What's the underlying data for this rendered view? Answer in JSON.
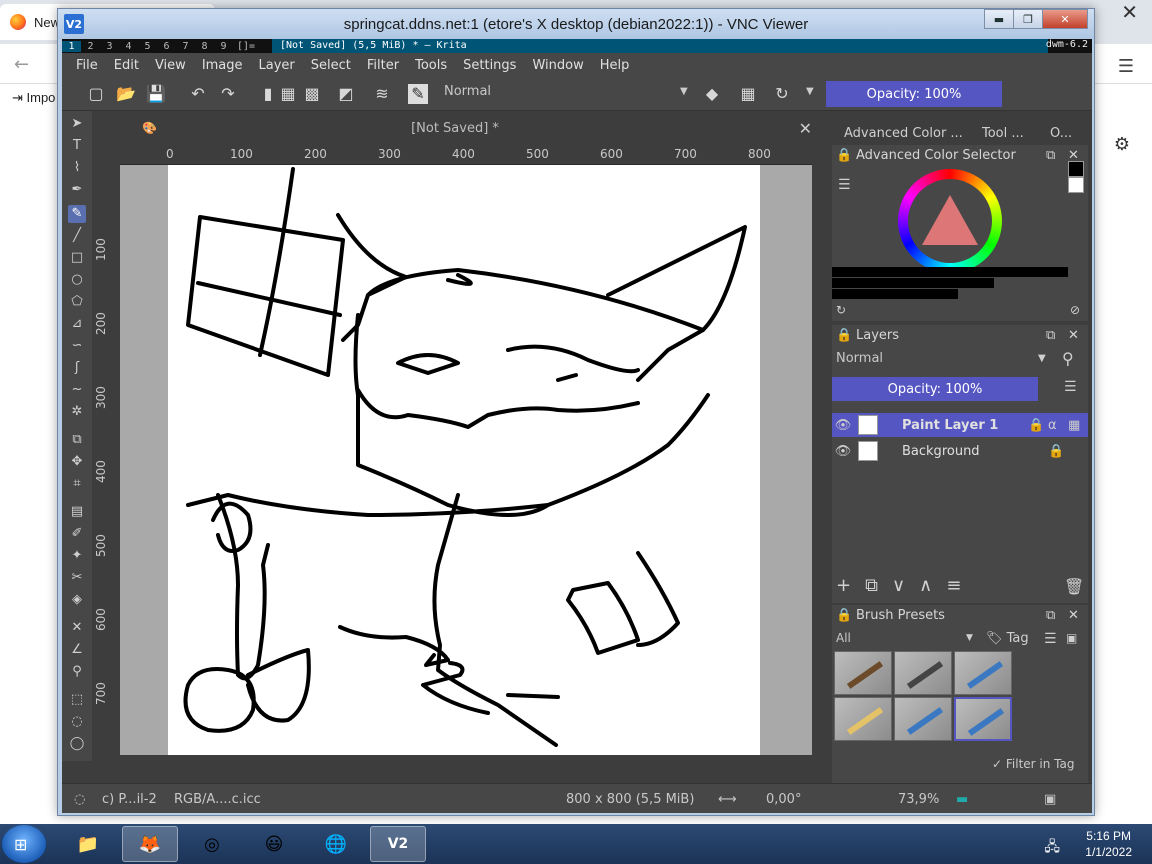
{
  "background_browser": {
    "tab_label": "New",
    "bookmark_label": "Impo"
  },
  "vnc": {
    "title": "springcat.ddns.net:1 (etore's X desktop (debian2022:1)) - VNC Viewer",
    "logo_text": "V2"
  },
  "dwm": {
    "tags": [
      "1",
      "2",
      "3",
      "4",
      "5",
      "6",
      "7",
      "8",
      "9"
    ],
    "layout": "[]=",
    "window_title": "[Not Saved]  (5,5 MiB)  * – Krita",
    "status": "dwm-6.2"
  },
  "krita": {
    "menu": [
      "File",
      "Edit",
      "View",
      "Image",
      "Layer",
      "Select",
      "Filter",
      "Tools",
      "Settings",
      "Window",
      "Help"
    ],
    "blend_mode": "Normal",
    "opacity_label": "Opacity: 100%",
    "document_title": "[Not Saved]  *",
    "ruler_h": [
      "0",
      "100",
      "200",
      "300",
      "400",
      "500",
      "600",
      "700",
      "800"
    ],
    "ruler_v": [
      "100",
      "200",
      "300",
      "400",
      "500",
      "600",
      "700"
    ],
    "status": {
      "brush": "c) P...il-2",
      "color_profile": "RGB/A....c.icc",
      "dimensions": "800 x 800 (5,5 MiB)",
      "rotation": "0,00°",
      "zoom": "73,9%"
    },
    "dock_tabs": [
      "Advanced Color ...",
      "Tool ...",
      "O..."
    ],
    "color_selector": {
      "title": "Advanced Color Selector"
    },
    "layers": {
      "title": "Layers",
      "mode": "Normal",
      "opacity_label": "Opacity:  100%",
      "items": [
        {
          "name": "Paint Layer 1",
          "selected": true
        },
        {
          "name": "Background",
          "selected": false
        }
      ]
    },
    "brush_presets": {
      "title": "Brush Presets",
      "filter": "All",
      "tag_label": "Tag",
      "filter_in_tag": "Filter in Tag"
    }
  },
  "taskbar": {
    "time": "5:16 PM",
    "date": "1/1/2022"
  },
  "colors": {
    "krita_bg": "#474747",
    "accent": "#5656c2",
    "dwm_accent": "#005577"
  }
}
